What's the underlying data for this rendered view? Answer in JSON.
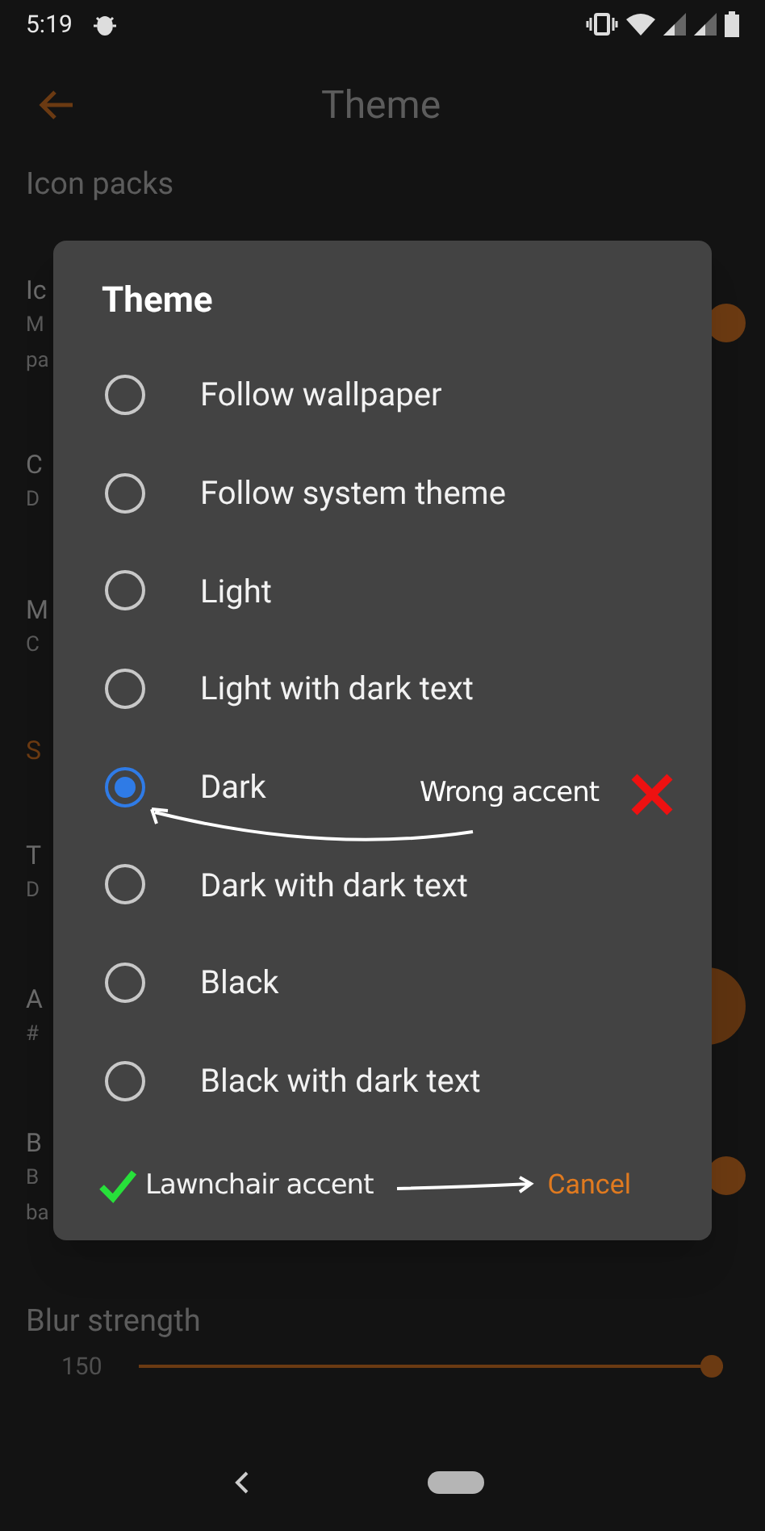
{
  "status_bar": {
    "time": "5:19"
  },
  "app_bar": {
    "title": "Theme"
  },
  "settings": [
    {
      "kind": "section",
      "title": "Icon packs"
    },
    {
      "kind": "switch",
      "title": "Ic",
      "summary": [
        "M",
        "pa"
      ],
      "on": true
    },
    {
      "kind": "item",
      "title": "C",
      "summary": [
        "D"
      ]
    },
    {
      "kind": "item",
      "title": "M",
      "summary": [
        "C"
      ]
    },
    {
      "kind": "category",
      "title": "S"
    },
    {
      "kind": "item",
      "title": "T",
      "summary": [
        "D"
      ]
    },
    {
      "kind": "swatch",
      "title": "A",
      "summary": [
        "#"
      ]
    },
    {
      "kind": "switch",
      "title": "B",
      "summary": [
        "B",
        "ba"
      ],
      "on": true
    },
    {
      "kind": "slider",
      "title": "Blur strength",
      "reading": "150",
      "level": 1
    }
  ],
  "dialog": {
    "title": "Theme",
    "options": [
      {
        "label": "Follow wallpaper",
        "selected": false
      },
      {
        "label": "Follow system theme",
        "selected": false
      },
      {
        "label": "Light",
        "selected": false
      },
      {
        "label": "Light with dark text",
        "selected": false
      },
      {
        "label": "Dark",
        "selected": true
      },
      {
        "label": "Dark with dark text",
        "selected": false
      },
      {
        "label": "Black",
        "selected": false
      },
      {
        "label": "Black with dark text",
        "selected": false
      }
    ],
    "note": "Lawnchair accent",
    "button": "Cancel"
  },
  "annotation": {
    "text": "Wrong accent"
  }
}
